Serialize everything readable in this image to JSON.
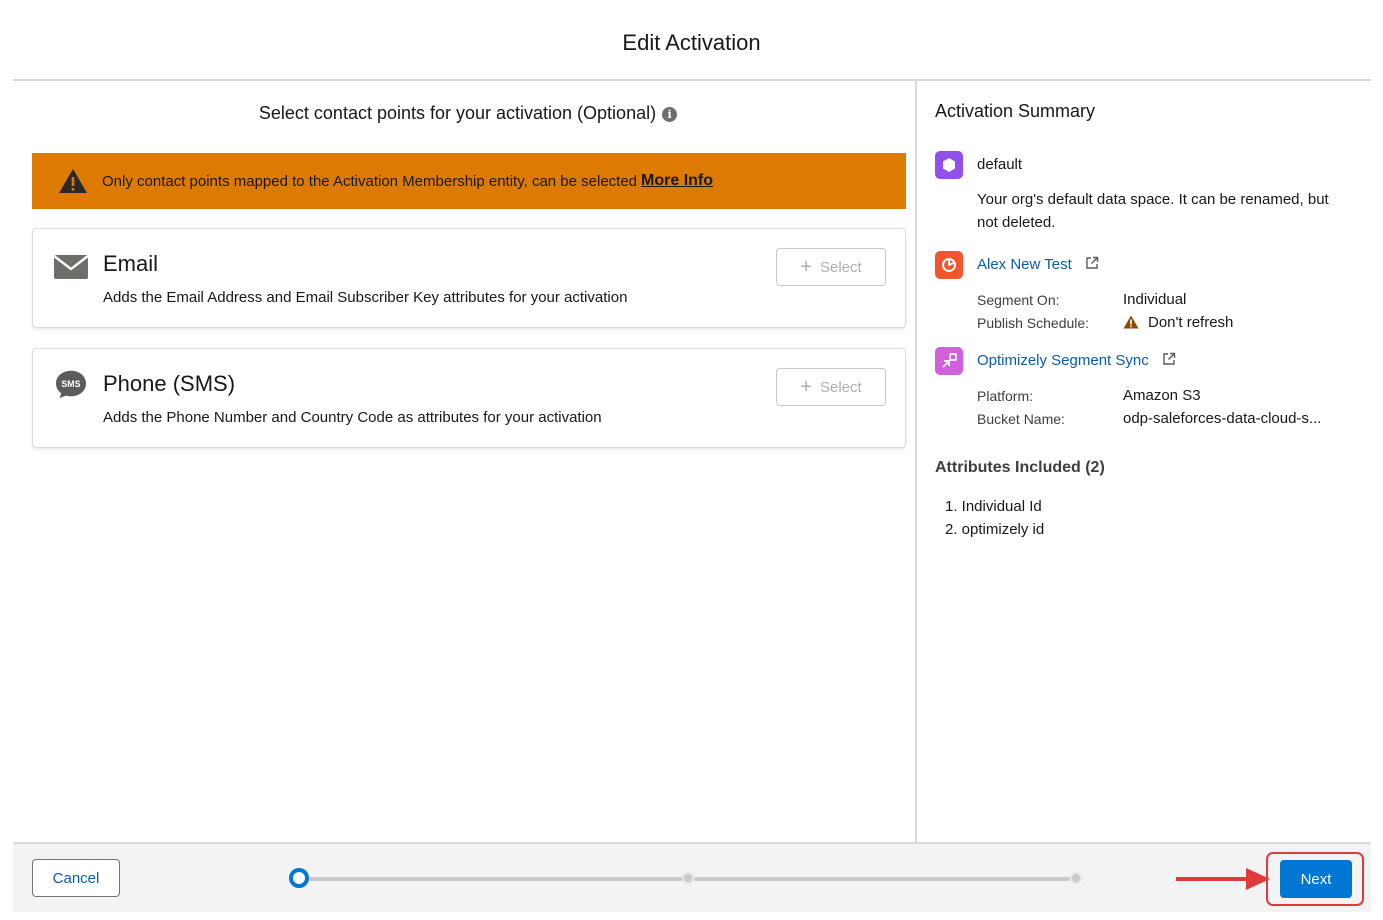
{
  "modal": {
    "title": "Edit Activation"
  },
  "contact_points": {
    "heading": "Select contact points for your activation (Optional)",
    "warning": {
      "text": "Only contact points mapped to the Activation Membership entity, can be selected",
      "link": "More Info"
    },
    "options": [
      {
        "icon": "email-icon",
        "title": "Email",
        "description": "Adds the Email Address and Email Subscriber Key attributes for your activation",
        "button": "Select"
      },
      {
        "icon": "sms-icon",
        "title": "Phone (SMS)",
        "description": "Adds the Phone Number and Country Code as attributes for your activation",
        "button": "Select"
      }
    ]
  },
  "summary": {
    "title": "Activation Summary",
    "data_space": {
      "icon": "data-space-icon",
      "name": "default",
      "description": "Your org's default data space. It can be renamed, but not deleted."
    },
    "segment": {
      "icon": "segment-icon",
      "name": "Alex New Test",
      "segment_on_label": "Segment On:",
      "segment_on_value": "Individual",
      "publish_schedule_label": "Publish Schedule:",
      "publish_schedule_value": "Don't refresh"
    },
    "target": {
      "icon": "activation-target-icon",
      "name": "Optimizely Segment Sync",
      "platform_label": "Platform:",
      "platform_value": "Amazon S3",
      "bucket_label": "Bucket Name:",
      "bucket_value": "odp-saleforces-data-cloud-s..."
    },
    "attributes": {
      "title": "Attributes Included (2)",
      "items": [
        "1. Individual Id",
        "2. optimizely id"
      ]
    }
  },
  "footer": {
    "cancel": "Cancel",
    "next": "Next",
    "progress": {
      "current_step": 1,
      "total_steps": 3
    }
  },
  "colors": {
    "brand": "#0176d3",
    "warning_banner": "#dd7a01",
    "link": "#0b5cab",
    "highlight": "#e03b3b"
  }
}
